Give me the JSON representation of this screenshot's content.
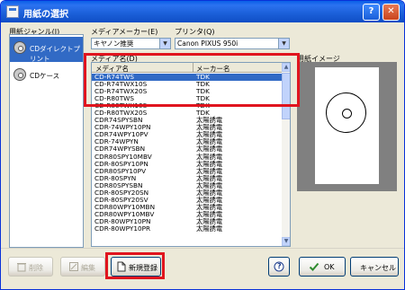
{
  "window": {
    "title": "用紙の選択"
  },
  "titlebar_buttons": {
    "help": "?",
    "close": "✕"
  },
  "genre": {
    "label": "用紙ジャンル(J)",
    "items": [
      {
        "label": "CDダイレクトプリント",
        "selected": true
      },
      {
        "label": "CDケース",
        "selected": false
      }
    ]
  },
  "maker": {
    "label": "メディアメーカー(E)",
    "value": "キヤノン推奨"
  },
  "printer": {
    "label": "プリンタ(Q)",
    "value": "Canon PIXUS 950i"
  },
  "media": {
    "label": "メディア名(D)",
    "columns": [
      "メディア名",
      "メーカー名"
    ],
    "rows": [
      [
        "CD-R74TWS",
        "TDK"
      ],
      [
        "CD-R74TWX10S",
        "TDK"
      ],
      [
        "CD-R74TWX20S",
        "TDK"
      ],
      [
        "CD-R80TWS",
        "TDK"
      ],
      [
        "CD-R80TWX10S",
        "TDK"
      ],
      [
        "CD-R80TWX20S",
        "TDK"
      ],
      [
        "CDR74SPYSBN",
        "太陽誘電"
      ],
      [
        "CDR-74WPY10PN",
        "太陽誘電"
      ],
      [
        "CDR74WPY10PV",
        "太陽誘電"
      ],
      [
        "CDR-74WPYN",
        "太陽誘電"
      ],
      [
        "CDR74WPYSBN",
        "太陽誘電"
      ],
      [
        "CDR80SPY10MBV",
        "太陽誘電"
      ],
      [
        "CDR-80SPY10PN",
        "太陽誘電"
      ],
      [
        "CDR80SPY10PV",
        "太陽誘電"
      ],
      [
        "CDR-80SPYN",
        "太陽誘電"
      ],
      [
        "CDR80SPYSBN",
        "太陽誘電"
      ],
      [
        "CDR-80SPY20SN",
        "太陽誘電"
      ],
      [
        "CDR-80SPY20SV",
        "太陽誘電"
      ],
      [
        "CDR80WPY10MBN",
        "太陽誘電"
      ],
      [
        "CDR80WPY10MBV",
        "太陽誘電"
      ],
      [
        "CDR-80WPY10PN",
        "太陽誘電"
      ],
      [
        "CDR-80WPY10PR",
        "太陽誘電"
      ]
    ],
    "selected_index": 0
  },
  "preview": {
    "label": "用紙イメージ"
  },
  "buttons": {
    "delete": "削除",
    "edit": "編集",
    "new": "新規登録",
    "help": "?",
    "ok": "OK",
    "cancel": "キャンセル"
  },
  "colors": {
    "highlight": "#e0141e",
    "selection": "#316ac5",
    "titlebar": "#0a5fe7"
  }
}
